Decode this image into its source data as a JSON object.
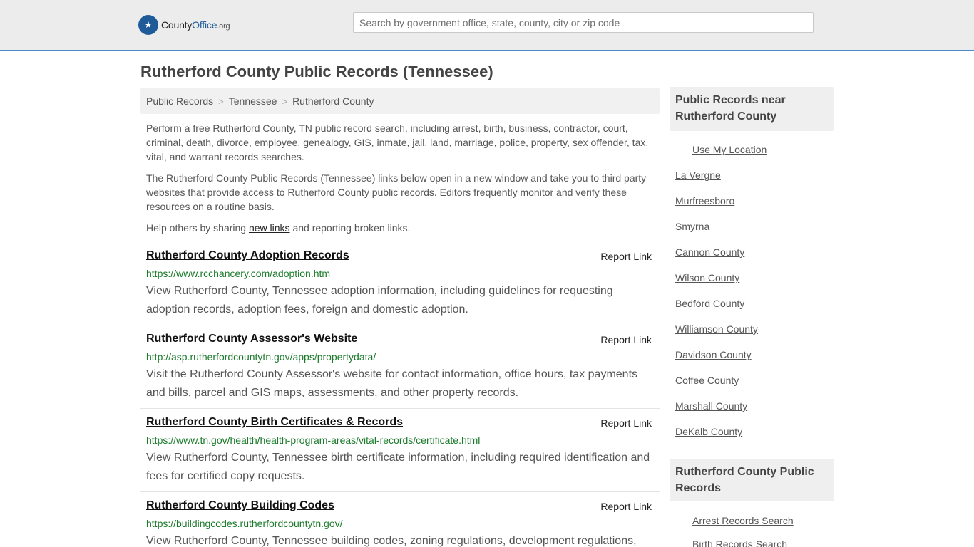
{
  "header": {
    "logo_badge": "★",
    "logo_part1": "County",
    "logo_part2": "Office",
    "logo_part3": ".org",
    "search_placeholder": "Search by government office, state, county, city or zip code"
  },
  "page_title": "Rutherford County Public Records (Tennessee)",
  "breadcrumb": {
    "items": [
      "Public Records",
      "Tennessee",
      "Rutherford County"
    ],
    "separator": ">"
  },
  "intro": {
    "p1": "Perform a free Rutherford County, TN public record search, including arrest, birth, business, contractor, court, criminal, death, divorce, employee, genealogy, GIS, inmate, jail, land, marriage, police, property, sex offender, tax, vital, and warrant records searches.",
    "p2": "The Rutherford County Public Records (Tennessee) links below open in a new window and take you to third party websites that provide access to Rutherford County public records. Editors frequently monitor and verify these resources on a routine basis.",
    "p3_before": "Help others by sharing ",
    "p3_link": "new links",
    "p3_after": " and reporting broken links."
  },
  "records": [
    {
      "title": "Rutherford County Adoption Records",
      "report": "Report Link",
      "url": "https://www.rcchancery.com/adoption.htm",
      "desc": "View Rutherford County, Tennessee adoption information, including guidelines for requesting adoption records, adoption fees, foreign and domestic adoption."
    },
    {
      "title": "Rutherford County Assessor's Website",
      "report": "Report Link",
      "url": "http://asp.rutherfordcountytn.gov/apps/propertydata/",
      "desc": "Visit the Rutherford County Assessor's website for contact information, office hours, tax payments and bills, parcel and GIS maps, assessments, and other property records."
    },
    {
      "title": "Rutherford County Birth Certificates & Records",
      "report": "Report Link",
      "url": "https://www.tn.gov/health/health-program-areas/vital-records/certificate.html",
      "desc": "View Rutherford County, Tennessee birth certificate information, including required identification and fees for certified copy requests."
    },
    {
      "title": "Rutherford County Building Codes",
      "report": "Report Link",
      "url": "https://buildingcodes.rutherfordcountytn.gov/",
      "desc": "View Rutherford County, Tennessee building codes, zoning regulations, development regulations,"
    }
  ],
  "sidebar": {
    "near_title": "Public Records near Rutherford County",
    "use_location": "Use My Location",
    "near_links": [
      "La Vergne",
      "Murfreesboro",
      "Smyrna",
      "Cannon County",
      "Wilson County",
      "Bedford County",
      "Williamson County",
      "Davidson County",
      "Coffee County",
      "Marshall County",
      "DeKalb County"
    ],
    "records_title": "Rutherford County Public Records",
    "record_links": [
      "Arrest Records Search",
      "Birth Records Search"
    ]
  }
}
